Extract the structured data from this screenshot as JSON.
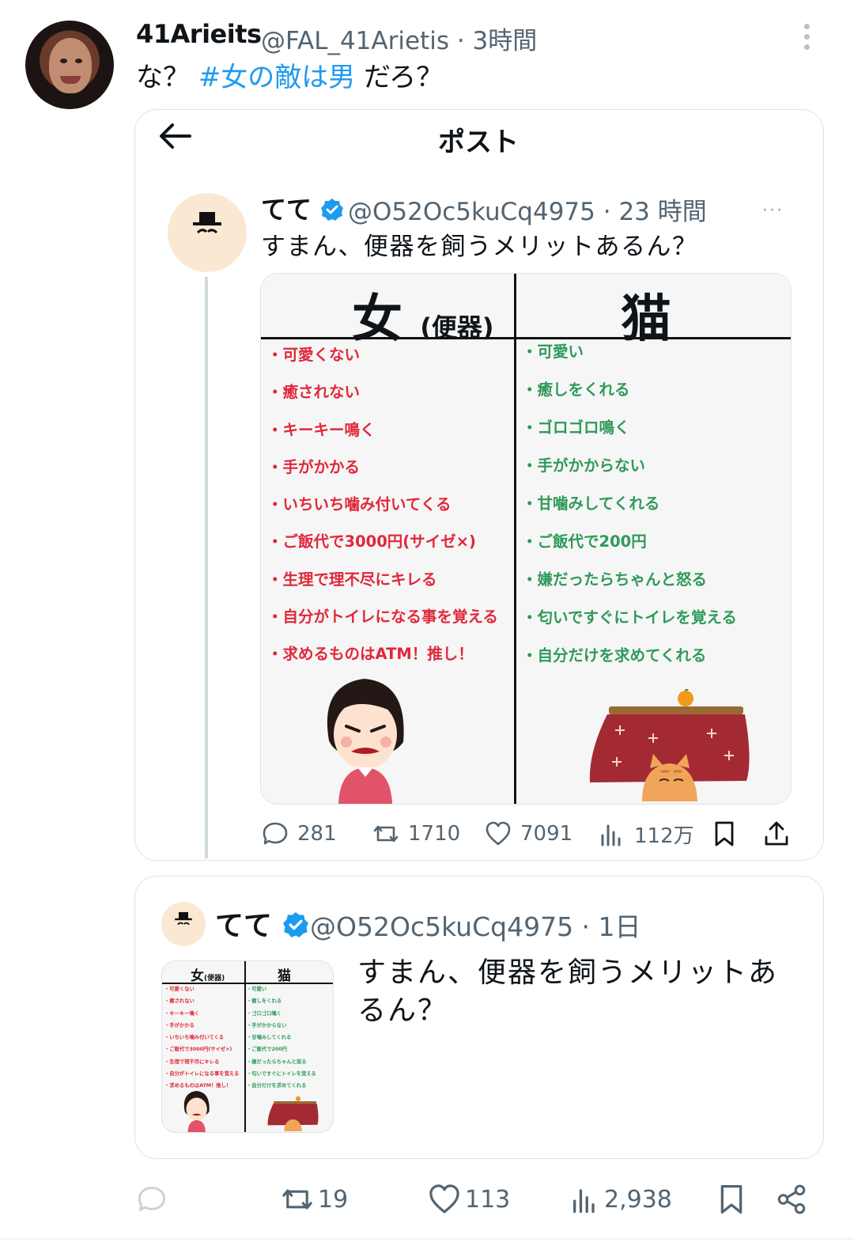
{
  "tweet": {
    "display_name": "41Arieits",
    "handle_time": "@FAL_41Arietis · 3時間",
    "text_before": "な？ ",
    "hashtag": "#女の敵は男",
    "text_after": " だろ？",
    "stats": {
      "replies": "",
      "retweets": "19",
      "likes": "113",
      "views": "2,938"
    }
  },
  "screenshot_card": {
    "header_title": "ポスト",
    "author_name": "てて",
    "author_handle_time": "@O52Oc5kuCq4975 · 23 時間",
    "more": "···",
    "text": "すまん、便器を飼うメリットあるん？",
    "image": {
      "left_header": "女",
      "left_header_small": "(便器)",
      "right_header": "猫",
      "left_items": [
        "・可愛くない",
        "・癒されない",
        "・キーキー鳴く",
        "・手がかかる",
        "・いちいち噛み付いてくる",
        "・ご飯代で3000円(サイゼ×)",
        "・生理で理不尽にキレる",
        "・自分がトイレになる事を覚える",
        "・求めるものはATM！推し！"
      ],
      "right_items": [
        "・可愛い",
        "・癒しをくれる",
        "・ゴロゴロ鳴く",
        "・手がかからない",
        "・甘噛みしてくれる",
        "・ご飯代で200円",
        "・嫌だったらちゃんと怒る",
        "・匂いですぐにトイレを覚える",
        "・自分だけを求めてくれる"
      ]
    },
    "stats": {
      "replies": "281",
      "retweets": "1710",
      "likes": "7091",
      "views": "112万"
    }
  },
  "quoted": {
    "author_name": "てて",
    "author_handle_time": "@O52Oc5kuCq4975 · 1日",
    "text": "すまん、便器を飼うメリットあるん？"
  },
  "colors": {
    "accent": "#1d9bf0",
    "muted": "#536471",
    "border": "#dfe3e7",
    "left_list": "#e0283a",
    "right_list": "#2e9a5a"
  }
}
